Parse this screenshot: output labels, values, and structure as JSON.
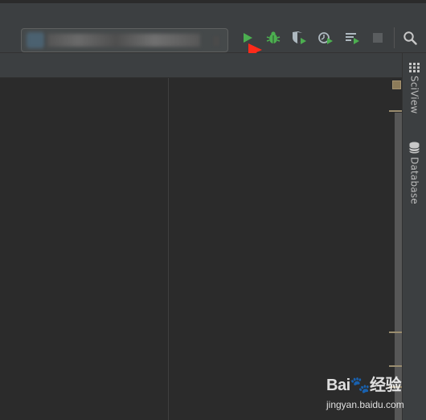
{
  "toolbar": {
    "run_config_icon": "python-file-icon",
    "buttons": [
      "run-icon",
      "debug-icon",
      "run-with-coverage-icon",
      "profile-icon",
      "concurrency-diagram-icon",
      "stop-icon",
      "search-icon"
    ]
  },
  "right_panel": {
    "tabs": [
      {
        "label": "SciView",
        "icon": "grid-icon"
      },
      {
        "label": "Database",
        "icon": "database-icon"
      }
    ]
  },
  "annotation": {
    "arrow_color": "#ff2a1a"
  },
  "watermark": {
    "brand": "Bai🐾经验",
    "url": "jingyan.baidu.com"
  },
  "colors": {
    "run_green": "#4caf50",
    "toolbar_bg": "#3c3f41",
    "editor_bg": "#2b2b2b"
  }
}
